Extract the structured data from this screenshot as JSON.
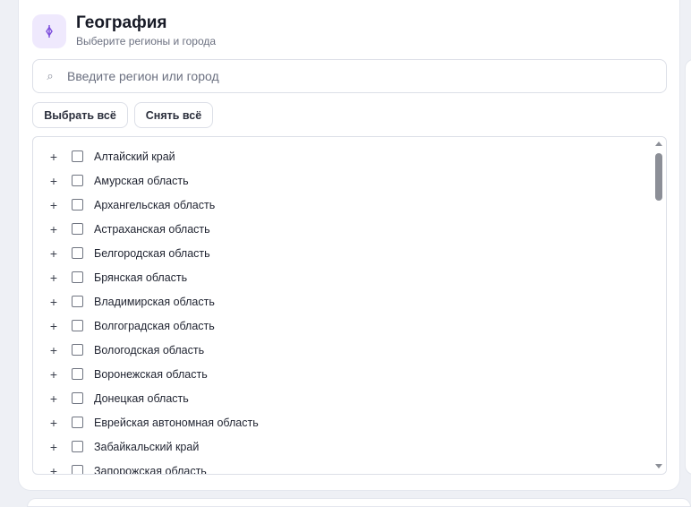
{
  "header": {
    "title": "География",
    "subtitle": "Выберите регионы и города",
    "icon": "location-pin-icon",
    "accent": "#7c4ddc"
  },
  "search": {
    "placeholder": "Введите регион или город",
    "value": "",
    "icon": "search-icon"
  },
  "actions": {
    "select_all": "Выбрать всё",
    "clear_all": "Снять всё"
  },
  "regions": [
    {
      "label": "Алтайский край",
      "checked": false
    },
    {
      "label": "Амурская область",
      "checked": false
    },
    {
      "label": "Архангельская область",
      "checked": false
    },
    {
      "label": "Астраханская область",
      "checked": false
    },
    {
      "label": "Белгородская область",
      "checked": false
    },
    {
      "label": "Брянская область",
      "checked": false
    },
    {
      "label": "Владимирская область",
      "checked": false
    },
    {
      "label": "Волгоградская область",
      "checked": false
    },
    {
      "label": "Вологодская область",
      "checked": false
    },
    {
      "label": "Воронежская область",
      "checked": false
    },
    {
      "label": "Донецкая область",
      "checked": false
    },
    {
      "label": "Еврейская автономная область",
      "checked": false
    },
    {
      "label": "Забайкальский край",
      "checked": false
    },
    {
      "label": "Запорожская область",
      "checked": false
    }
  ],
  "expand_symbol": "+"
}
